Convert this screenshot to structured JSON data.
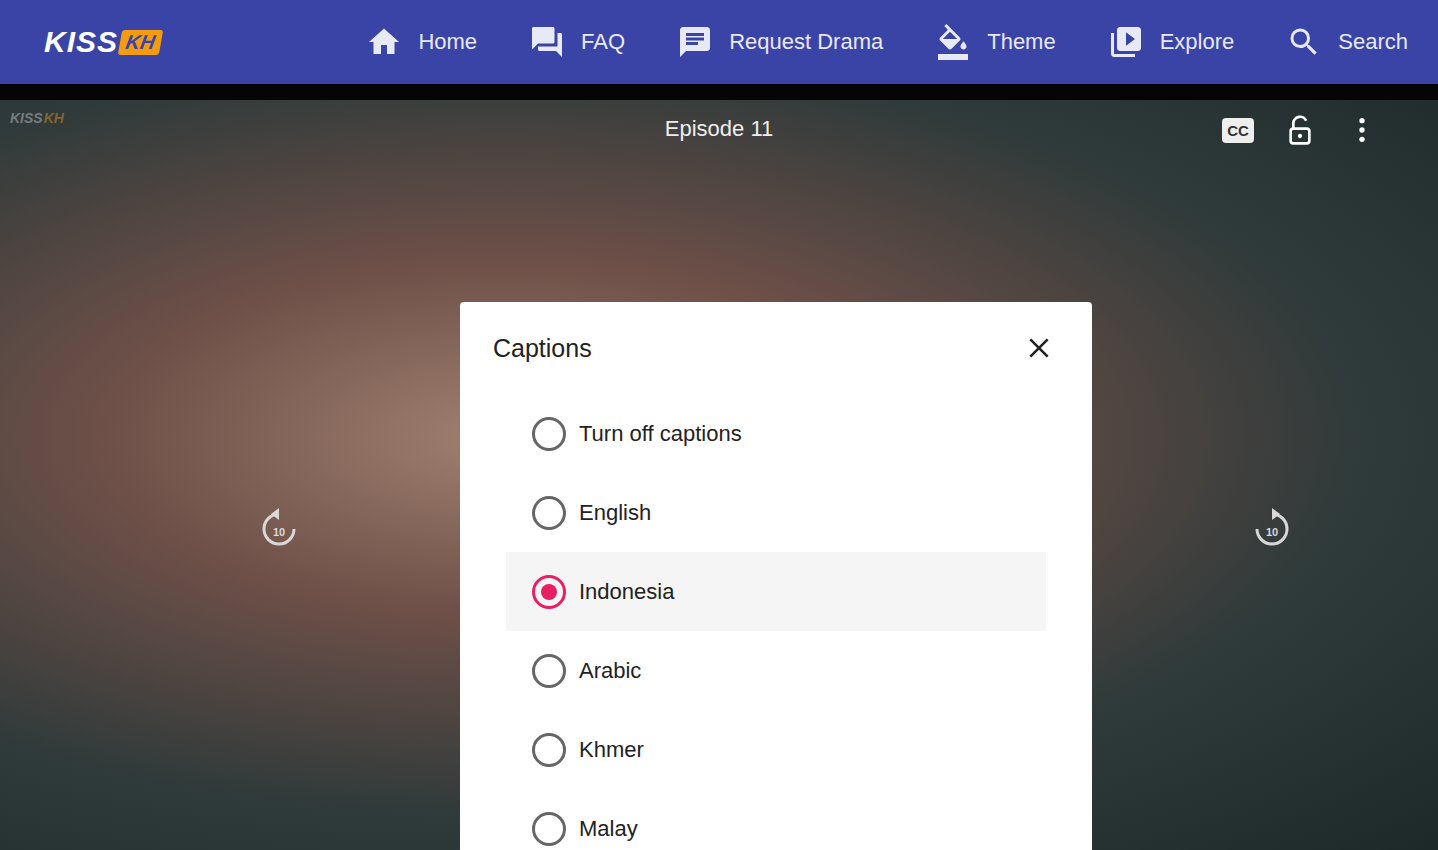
{
  "logo": {
    "main": "KISS",
    "badge": "KH"
  },
  "nav": [
    {
      "label": "Home"
    },
    {
      "label": "FAQ"
    },
    {
      "label": "Request Drama"
    },
    {
      "label": "Theme"
    },
    {
      "label": "Explore"
    },
    {
      "label": "Search"
    }
  ],
  "player": {
    "episode_title": "Episode 11",
    "cc_label": "CC",
    "rewind": "10",
    "forward": "10",
    "locked": false
  },
  "captions_dialog": {
    "title": "Captions",
    "options": [
      {
        "label": "Turn off captions",
        "selected": false
      },
      {
        "label": "English",
        "selected": false
      },
      {
        "label": "Indonesia",
        "selected": true
      },
      {
        "label": "Arabic",
        "selected": false
      },
      {
        "label": "Khmer",
        "selected": false
      },
      {
        "label": "Malay",
        "selected": false
      }
    ]
  }
}
